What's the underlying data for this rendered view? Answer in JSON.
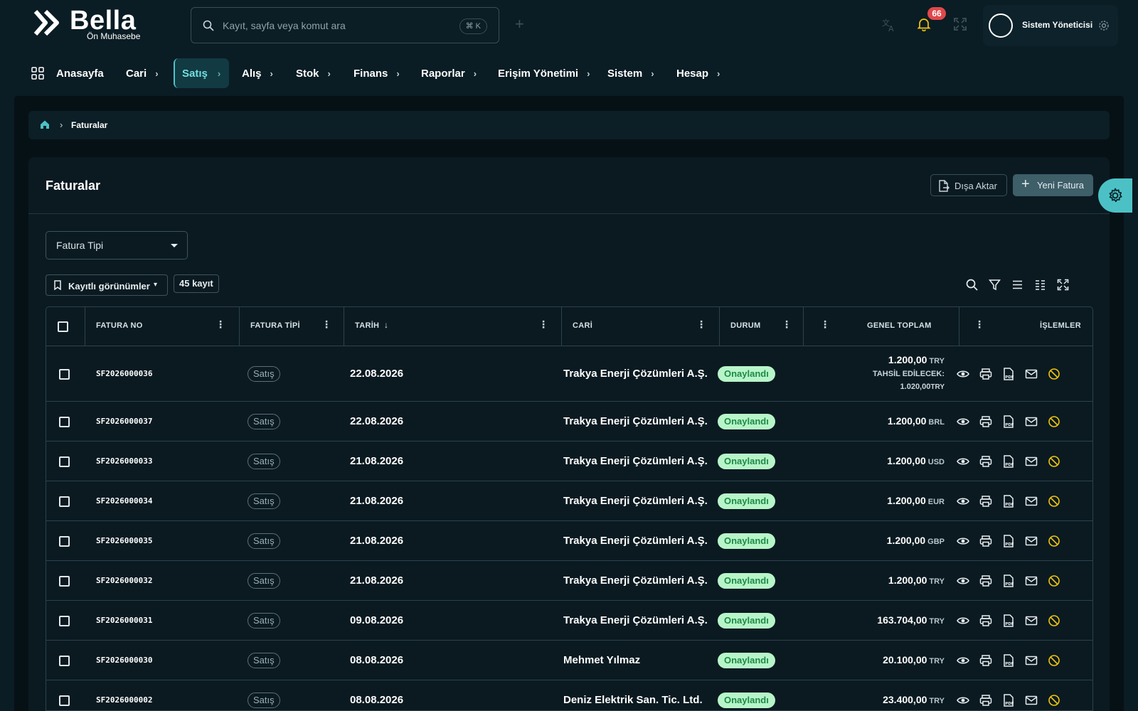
{
  "header": {
    "logo_word": "Bella",
    "logo_sub": "Ön Muhasebe",
    "search_placeholder": "Kayıt, sayfa veya komut ara",
    "search_shortcut": "⌘ K",
    "notification_count": "66",
    "user_name": "Sistem Yöneticisi",
    "icons": [
      "translate-icon",
      "bell-icon",
      "fullscreen-icon",
      "gear-icon"
    ]
  },
  "nav": {
    "items": [
      {
        "label": "Anasayfa"
      },
      {
        "label": "Cari"
      },
      {
        "label": "Satış"
      },
      {
        "label": "Alış"
      },
      {
        "label": "Stok"
      },
      {
        "label": "Finans"
      },
      {
        "label": "Raporlar"
      },
      {
        "label": "Erişim Yönetimi"
      },
      {
        "label": "Sistem"
      },
      {
        "label": "Hesap"
      }
    ],
    "active": "Satış"
  },
  "breadcrumb": {
    "current": "Faturalar"
  },
  "page": {
    "title": "Faturalar",
    "export_label": "Dışa Aktar",
    "new_label": "Yeni Fatura",
    "filter_select": "Fatura Tipi",
    "saved_views": "Kayıtlı görünümler",
    "record_count": "45 kayıt"
  },
  "table": {
    "columns": [
      "FATURA NO",
      "FATURA TİPİ",
      "TARİH",
      "CARİ",
      "DURUM",
      "GENEL TOPLAM",
      "İŞLEMLER"
    ],
    "tahsil_label": "TAHSİL EDİLECEK:",
    "rows": [
      {
        "no": "SF2026000036",
        "type": "Satış",
        "date": "22.08.2026",
        "cari": "Trakya Enerji Çözümleri A.Ş.",
        "status": "Onaylandı",
        "total": "1.200,00",
        "currency": "TRY",
        "tahsil": "1.020,00",
        "tahsil_currency": "TRY"
      },
      {
        "no": "SF2026000037",
        "type": "Satış",
        "date": "22.08.2026",
        "cari": "Trakya Enerji Çözümleri A.Ş.",
        "status": "Onaylandı",
        "total": "1.200,00",
        "currency": "BRL"
      },
      {
        "no": "SF2026000033",
        "type": "Satış",
        "date": "21.08.2026",
        "cari": "Trakya Enerji Çözümleri A.Ş.",
        "status": "Onaylandı",
        "total": "1.200,00",
        "currency": "USD"
      },
      {
        "no": "SF2026000034",
        "type": "Satış",
        "date": "21.08.2026",
        "cari": "Trakya Enerji Çözümleri A.Ş.",
        "status": "Onaylandı",
        "total": "1.200,00",
        "currency": "EUR"
      },
      {
        "no": "SF2026000035",
        "type": "Satış",
        "date": "21.08.2026",
        "cari": "Trakya Enerji Çözümleri A.Ş.",
        "status": "Onaylandı",
        "total": "1.200,00",
        "currency": "GBP"
      },
      {
        "no": "SF2026000032",
        "type": "Satış",
        "date": "21.08.2026",
        "cari": "Trakya Enerji Çözümleri A.Ş.",
        "status": "Onaylandı",
        "total": "1.200,00",
        "currency": "TRY"
      },
      {
        "no": "SF2026000031",
        "type": "Satış",
        "date": "09.08.2026",
        "cari": "Trakya Enerji Çözümleri A.Ş.",
        "status": "Onaylandı",
        "total": "163.704,00",
        "currency": "TRY"
      },
      {
        "no": "SF2026000030",
        "type": "Satış",
        "date": "08.08.2026",
        "cari": "Mehmet Yılmaz",
        "status": "Onaylandı",
        "total": "20.100,00",
        "currency": "TRY"
      },
      {
        "no": "SF2026000002",
        "type": "Satış",
        "date": "08.08.2026",
        "cari": "Deniz Elektrik San. Tic. Ltd.",
        "status": "Onaylandı",
        "total": "23.400,00",
        "currency": "TRY"
      }
    ],
    "row_actions": [
      "view-icon",
      "print-icon",
      "pdf-icon",
      "mail-icon",
      "cancel-icon"
    ]
  },
  "colors": {
    "background": "#0a1c24",
    "accent": "#4cc1c5",
    "status_bg": "#b7f5c9",
    "status_text": "#1f8a47",
    "badge": "#e0484b"
  }
}
